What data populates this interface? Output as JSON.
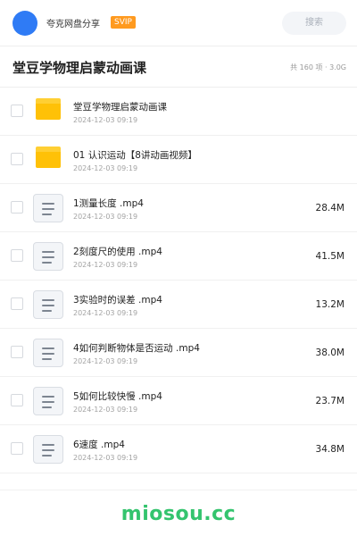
{
  "header": {
    "username": "夸克网盘分享",
    "badge": "SVIP",
    "search_label": "搜索"
  },
  "folder": {
    "title": "堂豆学物理启蒙动画课",
    "summary": "共 160 项 · 3.0G"
  },
  "files": [
    {
      "type": "folder",
      "name": "堂豆学物理启蒙动画课",
      "date": "2024-12-03 09:19",
      "size": ""
    },
    {
      "type": "folder",
      "name": "01 认识运动【8讲动画视频】",
      "date": "2024-12-03 09:19",
      "size": ""
    },
    {
      "type": "file",
      "name": "1测量长度 .mp4",
      "date": "2024-12-03 09:19",
      "size": "28.4M"
    },
    {
      "type": "file",
      "name": "2刻度尺的使用 .mp4",
      "date": "2024-12-03 09:19",
      "size": "41.5M"
    },
    {
      "type": "file",
      "name": "3实验时的误差 .mp4",
      "date": "2024-12-03 09:19",
      "size": "13.2M"
    },
    {
      "type": "file",
      "name": "4如何判断物体是否运动 .mp4",
      "date": "2024-12-03 09:19",
      "size": "38.0M"
    },
    {
      "type": "file",
      "name": "5如何比较快慢 .mp4",
      "date": "2024-12-03 09:19",
      "size": "23.7M"
    },
    {
      "type": "file",
      "name": "6速度 .mp4",
      "date": "2024-12-03 09:19",
      "size": "34.8M"
    }
  ],
  "footer": {
    "watermark": "miosou.cc"
  },
  "colors": {
    "avatar": "#2f7bf5",
    "badge": "#ff9a1f",
    "folder": "#ffc107",
    "watermark": "#34c46e"
  }
}
